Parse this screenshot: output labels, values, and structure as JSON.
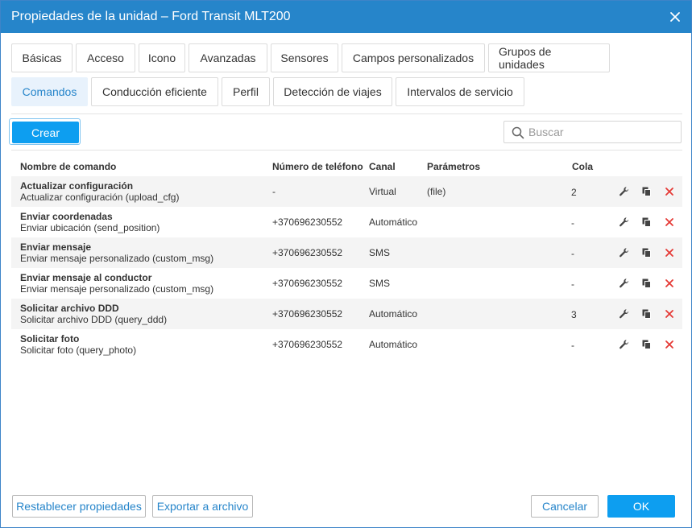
{
  "dialog": {
    "title": "Propiedades de la unidad – Ford Transit MLT200"
  },
  "tabs_row1": [
    "Básicas",
    "Acceso",
    "Icono",
    "Avanzadas",
    "Sensores",
    "Campos personalizados",
    "Grupos de unidades"
  ],
  "tabs_row2": [
    "Comandos",
    "Conducción eficiente",
    "Perfil",
    "Detección de viajes",
    "Intervalos de servicio"
  ],
  "active_tab": "Comandos",
  "toolbar": {
    "create_label": "Crear",
    "search_placeholder": "Buscar"
  },
  "table": {
    "headers": {
      "name": "Nombre de comando",
      "phone": "Número de teléfono",
      "channel": "Canal",
      "params": "Parámetros",
      "queue": "Cola"
    },
    "rows": [
      {
        "name": "Actualizar configuración",
        "desc": "Actualizar configuración (upload_cfg)",
        "phone": "-",
        "channel": "Virtual",
        "params": "(file)",
        "queue": "2"
      },
      {
        "name": "Enviar coordenadas",
        "desc": "Enviar ubicación (send_position)",
        "phone": "+370696230552",
        "channel": "Automático",
        "params": "",
        "queue": "-"
      },
      {
        "name": "Enviar mensaje",
        "desc": "Enviar mensaje personalizado (custom_msg)",
        "phone": "+370696230552",
        "channel": "SMS",
        "params": "",
        "queue": "-"
      },
      {
        "name": "Enviar mensaje al conductor",
        "desc": "Enviar mensaje personalizado (custom_msg)",
        "phone": "+370696230552",
        "channel": "SMS",
        "params": "",
        "queue": "-"
      },
      {
        "name": "Solicitar archivo DDD",
        "desc": "Solicitar archivo DDD (query_ddd)",
        "phone": "+370696230552",
        "channel": "Automático",
        "params": "",
        "queue": "3"
      },
      {
        "name": "Solicitar foto",
        "desc": "Solicitar foto (query_photo)",
        "phone": "+370696230552",
        "channel": "Automático",
        "params": "",
        "queue": "-"
      }
    ]
  },
  "footer": {
    "reset_label": "Restablecer propiedades",
    "export_label": "Exportar a archivo",
    "cancel_label": "Cancelar",
    "ok_label": "OK"
  },
  "colors": {
    "titlebar": "#2685ca",
    "primary": "#0d9ef0",
    "delete": "#e53935",
    "active_tab_bg": "#e8f2fc"
  },
  "icons": {
    "close": "close-icon",
    "search": "search-icon",
    "edit": "wrench-icon",
    "copy": "copy-icon",
    "delete": "delete-icon"
  }
}
